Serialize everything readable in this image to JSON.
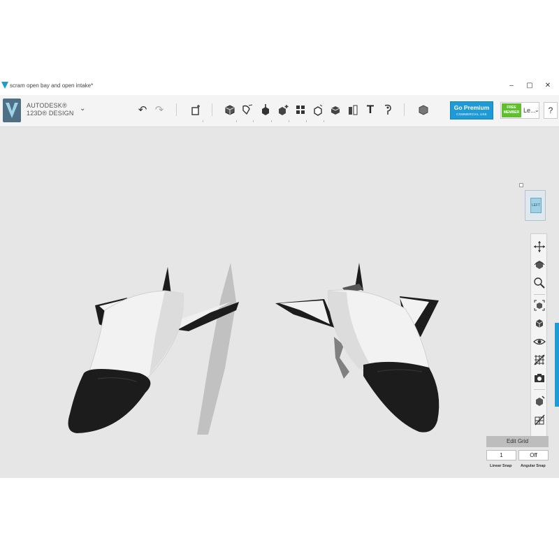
{
  "window": {
    "title": "scram open bay and open intake*",
    "controls": {
      "minimize": "–",
      "restore": "▢",
      "close": "✕"
    }
  },
  "brand": {
    "line1": "AUTODESK®",
    "line2": "123D® DESIGN",
    "menu_chevron": "⌄"
  },
  "toolbar": {
    "undo": "↶",
    "redo": "↷",
    "text_tool": "T",
    "tools": [
      "transform-icon",
      "primitives-icon",
      "sketch-icon",
      "construct-icon",
      "modify-icon",
      "pattern-icon",
      "grouping-icon",
      "combine-icon",
      "measure-icon",
      "snap-icon",
      "text-icon",
      "material-icon",
      "shape-icon"
    ]
  },
  "premium": {
    "label": "Go Premium",
    "sublabel": "COMMERCIAL USE"
  },
  "account": {
    "badge_line1": "FREE",
    "badge_line2": "MEMBER",
    "name": "Le...",
    "chevron": "⌄"
  },
  "help_label": "?",
  "viewcube": {
    "face": "LEFT"
  },
  "grid": {
    "button": "Edit Grid",
    "linear_snap_value": "1",
    "angular_snap_value": "Off",
    "linear_snap_label": "Linear Snap",
    "angular_snap_label": "Angular Snap"
  },
  "colors": {
    "accent": "#1e9ad6",
    "member_green": "#5fbf2f",
    "viewport_bg": "#e6e6e6",
    "body_white": "#f2f2f2",
    "body_black": "#1c1c1c"
  }
}
